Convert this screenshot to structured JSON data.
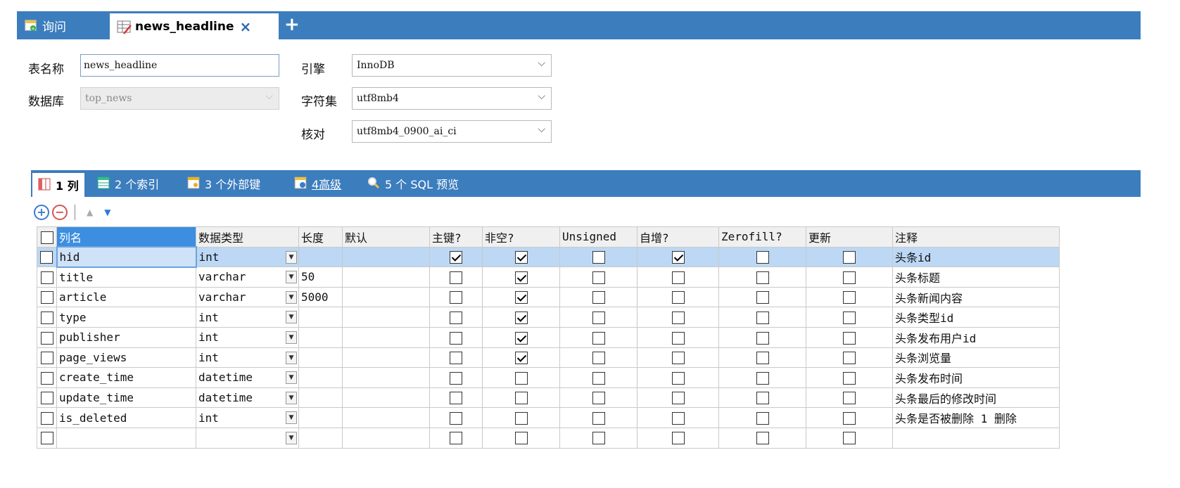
{
  "tabs": {
    "query_label": "询问",
    "table_label": "news_headline",
    "close": "×",
    "add": "+"
  },
  "form": {
    "table_name_label": "表名称",
    "table_name_value": "news_headline",
    "database_label": "数据库",
    "database_value": "top_news",
    "engine_label": "引擎",
    "engine_value": "InnoDB",
    "charset_label": "字符集",
    "charset_value": "utf8mb4",
    "collation_label": "核对",
    "collation_value": "utf8mb4_0900_ai_ci"
  },
  "subtabs": {
    "columns": "1 列",
    "indexes": "2 个索引",
    "foreign_keys": "3 个外部键",
    "advanced": "4高级",
    "sql_preview": "5 个 SQL 预览"
  },
  "toolbar": {
    "add": "+",
    "remove": "−",
    "up": "▲",
    "down": "▼"
  },
  "grid": {
    "headers": {
      "name": "列名",
      "type": "数据类型",
      "length": "长度",
      "default": "默认",
      "pk": "主键?",
      "not_null": "非空?",
      "unsigned": "Unsigned",
      "auto_inc": "自增?",
      "zerofill": "Zerofill?",
      "on_update": "更新",
      "comment": "注释"
    },
    "rows": [
      {
        "name": "hid",
        "type": "int",
        "length": "",
        "pk": true,
        "not_null": true,
        "unsigned": false,
        "auto_inc": true,
        "zerofill": false,
        "on_update": false,
        "comment": "头条id",
        "selected": true
      },
      {
        "name": "title",
        "type": "varchar",
        "length": "50",
        "pk": false,
        "not_null": true,
        "unsigned": false,
        "auto_inc": false,
        "zerofill": false,
        "on_update": false,
        "comment": "头条标题"
      },
      {
        "name": "article",
        "type": "varchar",
        "length": "5000",
        "pk": false,
        "not_null": true,
        "unsigned": false,
        "auto_inc": false,
        "zerofill": false,
        "on_update": false,
        "comment": "头条新闻内容"
      },
      {
        "name": "type",
        "type": "int",
        "length": "",
        "pk": false,
        "not_null": true,
        "unsigned": false,
        "auto_inc": false,
        "zerofill": false,
        "on_update": false,
        "comment": "头条类型id"
      },
      {
        "name": "publisher",
        "type": "int",
        "length": "",
        "pk": false,
        "not_null": true,
        "unsigned": false,
        "auto_inc": false,
        "zerofill": false,
        "on_update": false,
        "comment": "头条发布用户id"
      },
      {
        "name": "page_views",
        "type": "int",
        "length": "",
        "pk": false,
        "not_null": true,
        "unsigned": false,
        "auto_inc": false,
        "zerofill": false,
        "on_update": false,
        "comment": "头条浏览量"
      },
      {
        "name": "create_time",
        "type": "datetime",
        "length": "",
        "pk": false,
        "not_null": false,
        "unsigned": false,
        "auto_inc": false,
        "zerofill": false,
        "on_update": false,
        "comment": "头条发布时间"
      },
      {
        "name": "update_time",
        "type": "datetime",
        "length": "",
        "pk": false,
        "not_null": false,
        "unsigned": false,
        "auto_inc": false,
        "zerofill": false,
        "on_update": false,
        "comment": "头条最后的修改时间"
      },
      {
        "name": "is_deleted",
        "type": "int",
        "length": "",
        "pk": false,
        "not_null": false,
        "unsigned": false,
        "auto_inc": false,
        "zerofill": false,
        "on_update": false,
        "comment": "头条是否被删除 1 删除"
      },
      {
        "name": "",
        "type": "",
        "length": "",
        "pk": false,
        "not_null": false,
        "unsigned": false,
        "auto_inc": false,
        "zerofill": false,
        "on_update": false,
        "comment": ""
      }
    ]
  },
  "colors": {
    "accent": "#3c7dbd",
    "selected_row": "#bcd8f5"
  },
  "icons": [
    "query-icon",
    "table-design-icon",
    "columns-icon",
    "index-icon",
    "foreign-key-icon",
    "advanced-icon",
    "sql-preview-icon",
    "add-field-icon",
    "remove-field-icon"
  ]
}
